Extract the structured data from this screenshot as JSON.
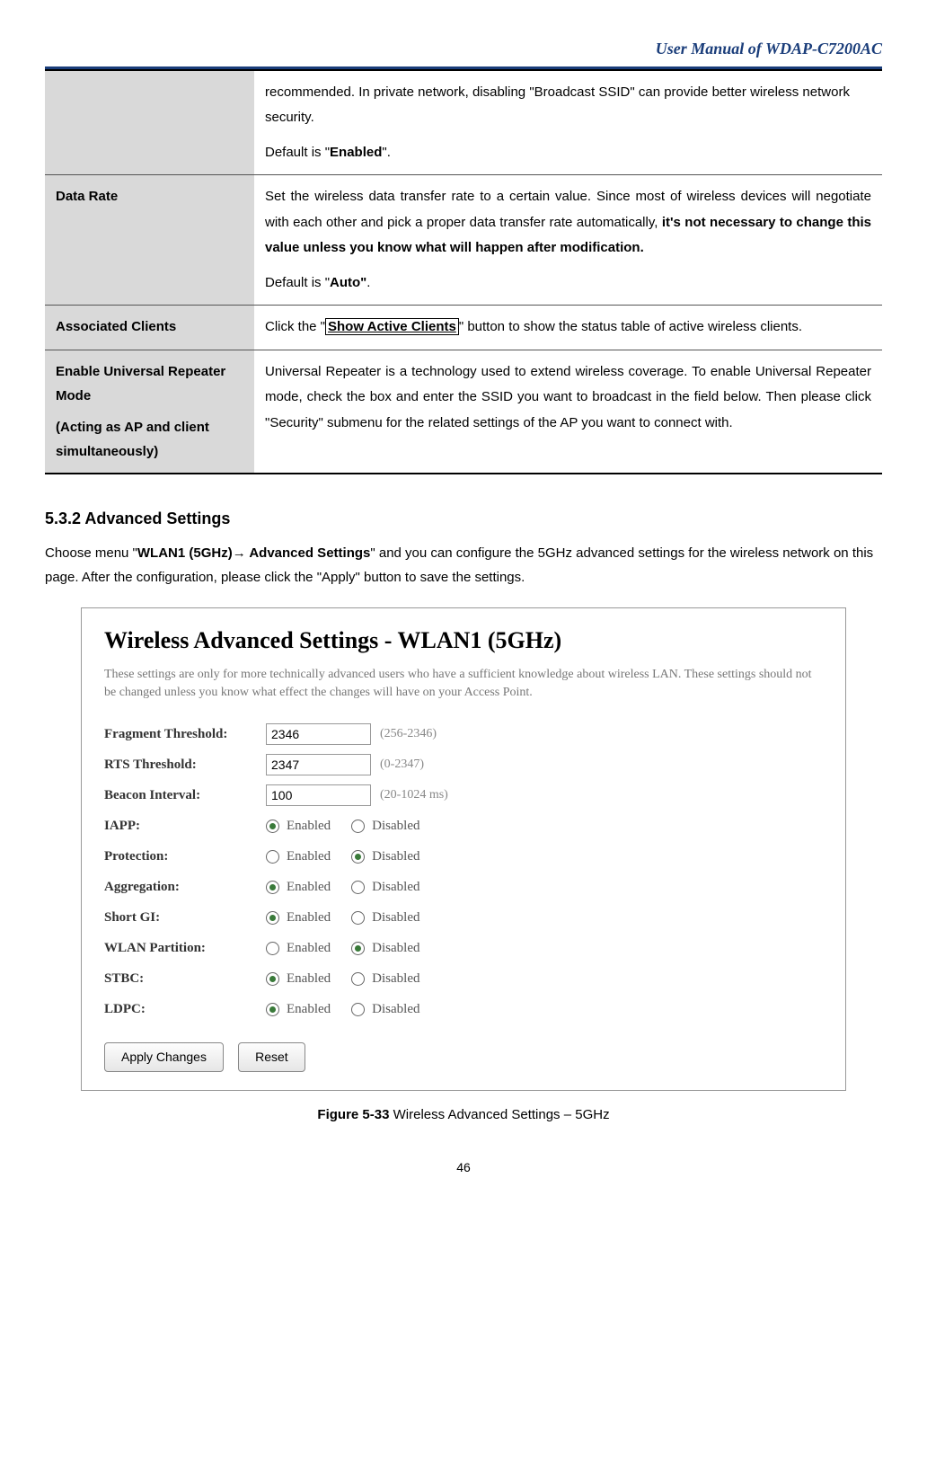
{
  "header": {
    "title": "User Manual of WDAP-C7200AC"
  },
  "table": {
    "row0": {
      "desc_p1a": "recommended. In private network, disabling \"Broadcast SSID\" can provide better wireless network security.",
      "desc_p2a": "Default is \"",
      "desc_p2b": "Enabled",
      "desc_p2c": "\"."
    },
    "row1": {
      "label": "Data Rate",
      "desc_p1a": "Set the wireless data transfer rate to a certain value. Since most of wireless devices will negotiate with each other and pick a proper data transfer rate automatically, ",
      "desc_p1b": "it's not necessary to change this value unless you know what will happen after modification.",
      "desc_p2a": "Default is \"",
      "desc_p2b": "Auto\"",
      "desc_p2c": "."
    },
    "row2": {
      "label": "Associated Clients",
      "desc_a": "Click the \"",
      "desc_b": "Show Active Clients",
      "desc_c": "\" button to show the status table of active wireless clients."
    },
    "row3": {
      "label_l1": "Enable Universal Repeater Mode",
      "label_l2": "(Acting as AP and client simultaneously)",
      "desc": "Universal Repeater is a technology used to extend wireless coverage. To enable Universal Repeater mode, check the box and enter the SSID you want to broadcast in the field below. Then please click \"Security\" submenu for the related settings of the AP you want to connect with."
    }
  },
  "section": {
    "heading": "5.3.2  Advanced Settings",
    "intro_a": "Choose menu \"",
    "intro_b": "WLAN1 (5GHz)→ Advanced Settings",
    "intro_c": "\" and you can configure the 5GHz advanced settings for the wireless network on this page. After the configuration, please click the \"Apply\" button to save the settings."
  },
  "figure": {
    "title": "Wireless Advanced Settings - WLAN1 (5GHz)",
    "subtitle": "These settings are only for more technically advanced users who have a sufficient knowledge about wireless LAN. These settings should not be changed unless you know what effect the changes will have on your Access Point.",
    "rows": {
      "fragment": {
        "label": "Fragment Threshold:",
        "value": "2346",
        "hint": "(256-2346)"
      },
      "rts": {
        "label": "RTS Threshold:",
        "value": "2347",
        "hint": "(0-2347)"
      },
      "beacon": {
        "label": "Beacon Interval:",
        "value": "100",
        "hint": "(20-1024 ms)"
      },
      "iapp": {
        "label": "IAPP:",
        "selected": "enabled"
      },
      "protection": {
        "label": "Protection:",
        "selected": "disabled"
      },
      "aggregation": {
        "label": "Aggregation:",
        "selected": "enabled"
      },
      "shortgi": {
        "label": "Short GI:",
        "selected": "enabled"
      },
      "wlanpart": {
        "label": "WLAN Partition:",
        "selected": "disabled"
      },
      "stbc": {
        "label": "STBC:",
        "selected": "enabled"
      },
      "ldpc": {
        "label": "LDPC:",
        "selected": "enabled"
      }
    },
    "radio_enabled_label": "Enabled",
    "radio_disabled_label": "Disabled",
    "btn_apply": "Apply Changes",
    "btn_reset": "Reset",
    "caption_a": "Figure 5-33",
    "caption_b": " Wireless Advanced Settings – 5GHz"
  },
  "page_number": "46"
}
